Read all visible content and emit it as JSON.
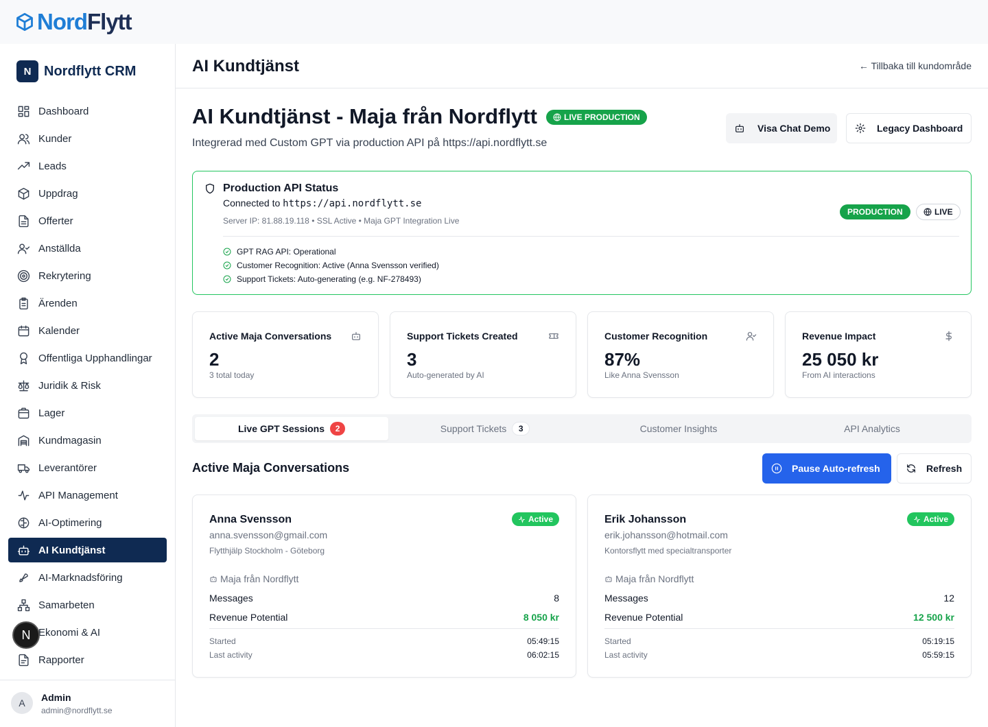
{
  "topbar": {
    "logo_part1": "Nord",
    "logo_part2": "Flytt"
  },
  "sidebar": {
    "brand_letter": "N",
    "brand_name": "Nordflytt CRM",
    "items": [
      {
        "label": "Dashboard",
        "icon": "dashboard-icon"
      },
      {
        "label": "Kunder",
        "icon": "users-icon"
      },
      {
        "label": "Leads",
        "icon": "trending-up-icon"
      },
      {
        "label": "Uppdrag",
        "icon": "package-icon"
      },
      {
        "label": "Offerter",
        "icon": "document-icon"
      },
      {
        "label": "Anställda",
        "icon": "user-check-icon"
      },
      {
        "label": "Rekrytering",
        "icon": "target-icon"
      },
      {
        "label": "Ärenden",
        "icon": "clipboard-icon"
      },
      {
        "label": "Kalender",
        "icon": "calendar-icon"
      },
      {
        "label": "Offentliga Upphandlingar",
        "icon": "award-icon"
      },
      {
        "label": "Juridik & Risk",
        "icon": "scale-icon"
      },
      {
        "label": "Lager",
        "icon": "box-icon"
      },
      {
        "label": "Kundmagasin",
        "icon": "warehouse-icon"
      },
      {
        "label": "Leverantörer",
        "icon": "truck-icon"
      },
      {
        "label": "API Management",
        "icon": "activity-icon"
      },
      {
        "label": "AI-Optimering",
        "icon": "brain-icon"
      },
      {
        "label": "AI Kundtjänst",
        "icon": "bot-icon",
        "active": true
      },
      {
        "label": "AI-Marknadsföring",
        "icon": "rocket-icon"
      },
      {
        "label": "Samarbeten",
        "icon": "network-icon"
      },
      {
        "label": "Ekonomi & AI",
        "icon": "calculator-icon"
      },
      {
        "label": "Rapporter",
        "icon": "report-icon"
      }
    ],
    "footer": {
      "avatar_letter": "A",
      "name": "Admin",
      "email": "admin@nordflytt.se"
    },
    "floating_letter": "N"
  },
  "header": {
    "title": "AI Kundtjänst",
    "back_link": "← Tillbaka till kundområde"
  },
  "page": {
    "title": "AI Kundtjänst - Maja från Nordflytt",
    "live_badge": "LIVE PRODUCTION",
    "subtitle": "Integrerad med Custom GPT via production API på https://api.nordflytt.se",
    "demo_button": "Visa Chat Demo",
    "legacy_button": "Legacy Dashboard"
  },
  "api_status": {
    "heading": "Production API Status",
    "connected_prefix": "Connected to ",
    "connected_url": "https://api.nordflytt.se",
    "meta": "Server IP: 81.88.19.118 • SSL Active • Maja GPT Integration Live",
    "tag_production": "PRODUCTION",
    "tag_live": "LIVE",
    "checks": [
      "GPT RAG API: Operational",
      "Customer Recognition: Active (Anna Svensson verified)",
      "Support Tickets: Auto-generating (e.g. NF-278493)"
    ]
  },
  "stats": [
    {
      "label": "Active Maja Conversations",
      "value": "2",
      "note": "3 total today",
      "icon": "bot-icon"
    },
    {
      "label": "Support Tickets Created",
      "value": "3",
      "note": "Auto-generated by AI",
      "icon": "ticket-icon"
    },
    {
      "label": "Customer Recognition",
      "value": "87%",
      "note": "Like Anna Svensson",
      "icon": "user-check-icon"
    },
    {
      "label": "Revenue Impact",
      "value": "25 050 kr",
      "note": "From AI interactions",
      "icon": "dollar-icon"
    }
  ],
  "tabs": [
    {
      "label": "Live GPT Sessions",
      "count": "2"
    },
    {
      "label": "Support Tickets",
      "count": "3"
    },
    {
      "label": "Customer Insights"
    },
    {
      "label": "API Analytics"
    }
  ],
  "conversations": {
    "title": "Active Maja Conversations",
    "pause_button": "Pause Auto-refresh",
    "refresh_button": "Refresh",
    "messages_label": "Messages",
    "revenue_label": "Revenue Potential",
    "started_label": "Started",
    "last_activity_label": "Last activity",
    "items": [
      {
        "name": "Anna Svensson",
        "email": "anna.svensson@gmail.com",
        "description": "Flytthjälp Stockholm - Göteborg",
        "status": "Active",
        "agent": "Maja från Nordflytt",
        "messages": "8",
        "revenue": "8 050 kr",
        "started": "05:49:15",
        "last_activity": "06:02:15"
      },
      {
        "name": "Erik Johansson",
        "email": "erik.johansson@hotmail.com",
        "description": "Kontorsflytt med specialtransporter",
        "status": "Active",
        "agent": "Maja från Nordflytt",
        "messages": "12",
        "revenue": "12 500 kr",
        "started": "05:19:15",
        "last_activity": "05:59:15"
      }
    ]
  }
}
